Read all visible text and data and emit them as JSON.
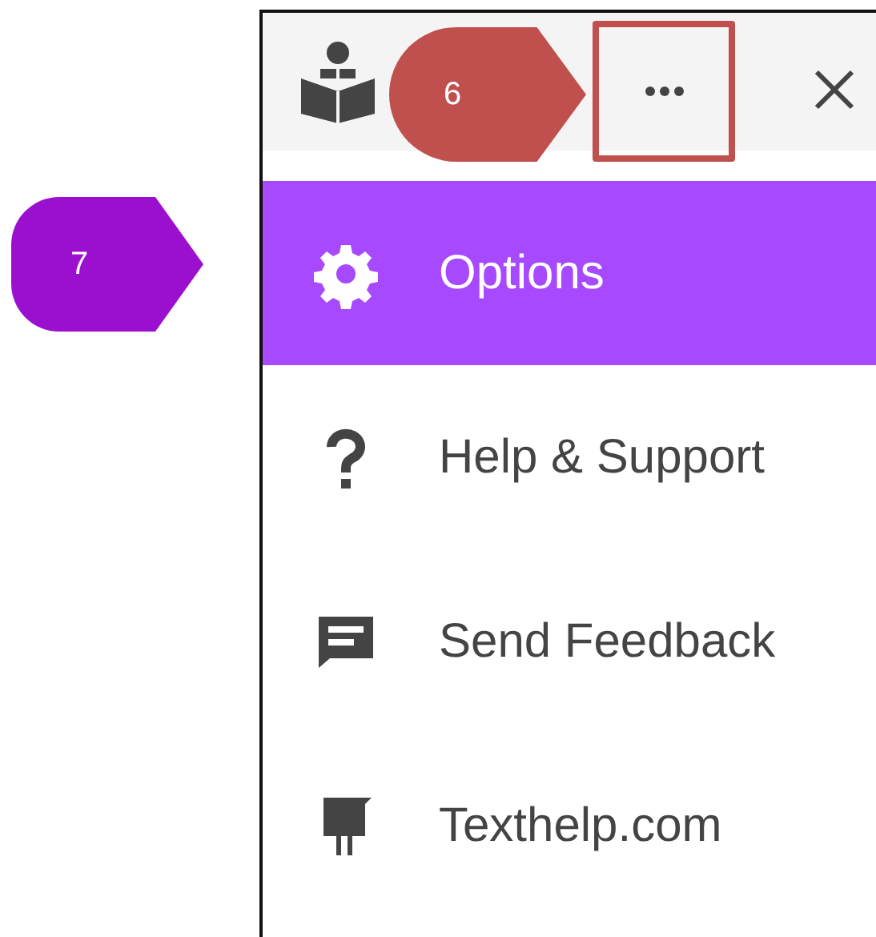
{
  "callouts": [
    {
      "label": "6",
      "color": "#c0504d"
    },
    {
      "label": "7",
      "color": "#9b0fcf"
    }
  ],
  "menu": [
    {
      "label": "Options",
      "kind": "gear",
      "selected": true
    },
    {
      "label": "Help & Support",
      "kind": "question",
      "selected": false
    },
    {
      "label": "Send Feedback",
      "kind": "chat",
      "selected": false
    },
    {
      "label": "Texthelp.com",
      "kind": "bird",
      "selected": false
    }
  ]
}
